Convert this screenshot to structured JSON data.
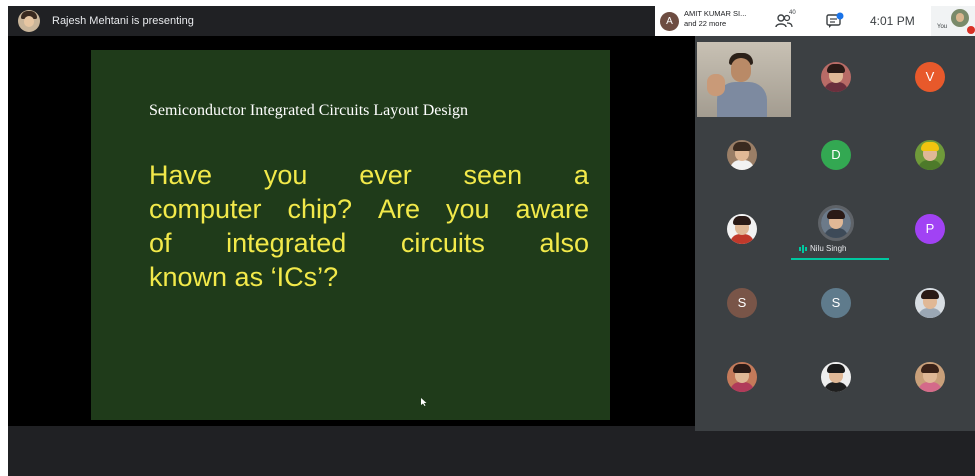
{
  "topbar": {
    "presenting_text": "Rajesh Mehtani is presenting",
    "participants_summary": {
      "avatar_initial": "A",
      "name": "AMIT KUMAR SI...",
      "more": "and 22 more"
    },
    "people_count": "40",
    "time": "4:01 PM",
    "self_label": "You"
  },
  "slide": {
    "title": "Semiconductor Integrated Circuits Layout Design",
    "body_lines": [
      [
        "Have",
        "you",
        "ever",
        "seen",
        "a"
      ],
      [
        "computer",
        "chip?",
        "Are",
        "you",
        "aware"
      ],
      [
        "of",
        "integrated",
        "circuits",
        "also"
      ],
      [
        "known as ‘ICs’?"
      ]
    ],
    "background_color": "#1f3b1a",
    "text_color": "#f2e94a"
  },
  "grid": {
    "participants": [
      {
        "id": "rajesh",
        "type": "video"
      },
      {
        "id": "p2",
        "type": "photo",
        "bg": "#b86b66",
        "hair": "#2a1a16",
        "body": "#6a2f3d"
      },
      {
        "id": "v",
        "type": "initial",
        "initial": "V",
        "bg": "#e8592b"
      },
      {
        "id": "p4",
        "type": "photo",
        "bg": "#9a7e66",
        "hair": "#3a2a1f",
        "body": "#f2f2f2"
      },
      {
        "id": "d",
        "type": "initial",
        "initial": "D",
        "bg": "#33a852"
      },
      {
        "id": "p6",
        "type": "photo",
        "bg": "#6f9a3a",
        "hair": "#f1c40f",
        "body": "#4d7a2a"
      },
      {
        "id": "p7",
        "type": "photo",
        "bg": "#f2f2f2",
        "hair": "#2a1a16",
        "body": "#c0392b"
      },
      {
        "id": "nilu",
        "type": "photo-speaking",
        "name": "Nilu Singh",
        "bg": "#6c7a89",
        "hair": "#2a1a16",
        "body": "#3d4a58"
      },
      {
        "id": "p",
        "type": "initial",
        "initial": "P",
        "bg": "#a142f4"
      },
      {
        "id": "s1",
        "type": "initial",
        "initial": "S",
        "bg": "#795548"
      },
      {
        "id": "s2",
        "type": "initial",
        "initial": "S",
        "bg": "#5f7b8c"
      },
      {
        "id": "p12",
        "type": "photo",
        "bg": "#d8dde2",
        "hair": "#2a1a16",
        "body": "#9aa7b4"
      },
      {
        "id": "p13",
        "type": "photo",
        "bg": "#c47a5a",
        "hair": "#2a1a16",
        "body": "#b03a5a"
      },
      {
        "id": "p14",
        "type": "photo",
        "bg": "#eeeeee",
        "hair": "#1a1a1a",
        "body": "#1f1f1f"
      },
      {
        "id": "p15",
        "type": "photo",
        "bg": "#c9a07a",
        "hair": "#3a2218",
        "body": "#d46a8a"
      }
    ],
    "speaking_color": "#00c8a0"
  }
}
